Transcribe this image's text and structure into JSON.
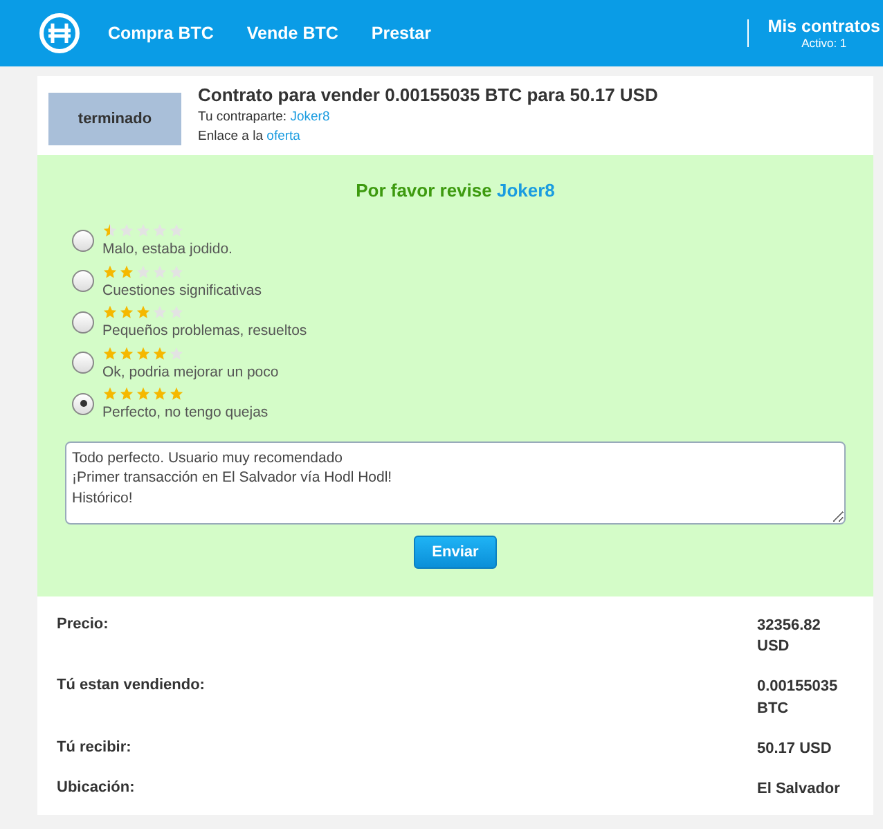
{
  "nav": {
    "links": [
      {
        "label": "Compra BTC"
      },
      {
        "label": "Vende BTC"
      },
      {
        "label": "Prestar"
      }
    ],
    "contracts": {
      "label": "Mis contratos",
      "sub": "Activo: 1"
    }
  },
  "contract": {
    "status": "terminado",
    "title": "Contrato para vender 0.00155035 BTC para 50.17 USD",
    "counterparty_label": "Tu contraparte:",
    "counterparty": "Joker8",
    "offer_label": "Enlace a la",
    "offer_link": "oferta"
  },
  "review": {
    "heading": "Por favor revise",
    "user": "Joker8",
    "options": [
      {
        "stars": 0.5,
        "label": "Malo, estaba jodido.",
        "selected": false
      },
      {
        "stars": 2,
        "label": "Cuestiones significativas",
        "selected": false
      },
      {
        "stars": 3,
        "label": "Pequeños problemas, resueltos",
        "selected": false
      },
      {
        "stars": 4,
        "label": "Ok, podria mejorar un poco",
        "selected": false
      },
      {
        "stars": 5,
        "label": "Perfecto, no tengo quejas",
        "selected": true
      }
    ],
    "comment": "Todo perfecto. Usuario muy recomendado\n¡Primer transacción en El Salvador vía Hodl Hodl!\nHistórico!",
    "submit": "Enviar"
  },
  "details": [
    {
      "label": "Precio:",
      "value": "32356.82 USD"
    },
    {
      "label": "Tú estan vendiendo:",
      "value": "0.00155035 BTC"
    },
    {
      "label": "Tú recibir:",
      "value": "50.17 USD"
    },
    {
      "label": "Ubicación:",
      "value": "El Salvador"
    }
  ]
}
